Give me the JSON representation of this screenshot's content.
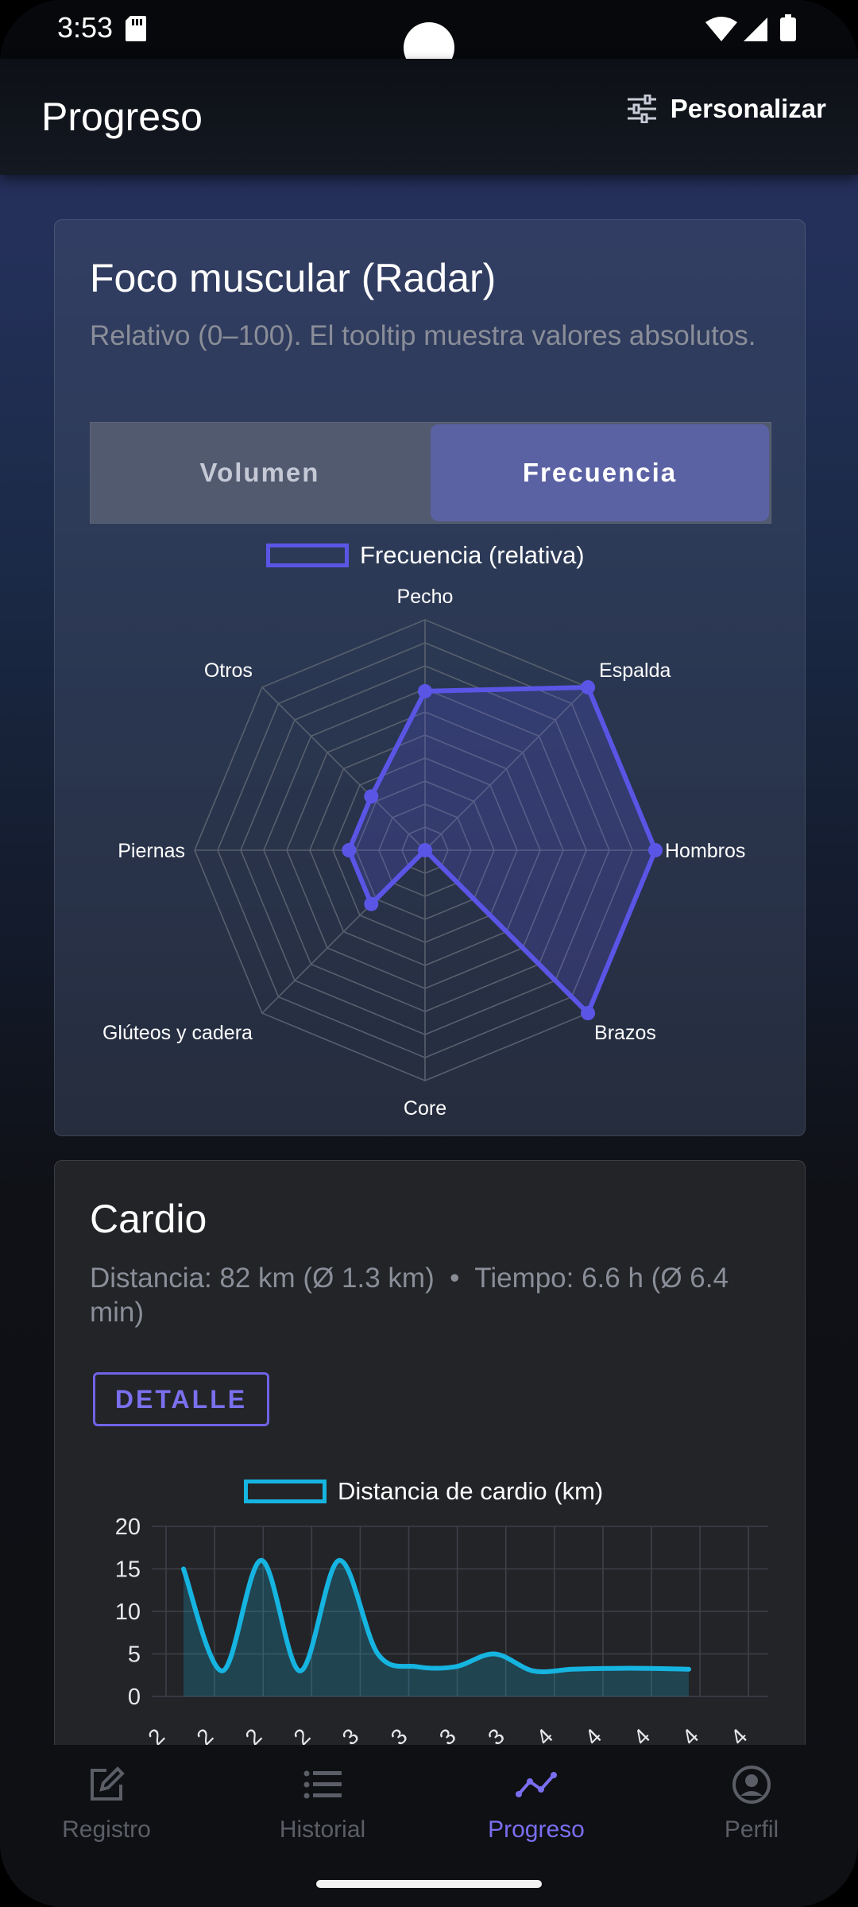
{
  "status_bar": {
    "time": "3:53"
  },
  "app_bar": {
    "title": "Progreso",
    "customize_label": "Personalizar"
  },
  "radar_card": {
    "title": "Foco muscular (Radar)",
    "subtitle": "Relativo (0–100). El tooltip muestra valores absolutos.",
    "tabs": [
      {
        "label": "Volumen",
        "selected": false
      },
      {
        "label": "Frecuencia",
        "selected": true
      }
    ]
  },
  "cardio_card": {
    "title": "Cardio",
    "summary": "Distancia: 82 km (Ø 1.3 km)  •  Tiempo: 6.6 h (Ø 6.4 min)",
    "detail_button": "DETALLE"
  },
  "bottom_nav": {
    "items": [
      {
        "label": "Registro",
        "icon": "edit-icon",
        "active": false
      },
      {
        "label": "Historial",
        "icon": "list-icon",
        "active": false
      },
      {
        "label": "Progreso",
        "icon": "trending-icon",
        "active": true
      },
      {
        "label": "Perfil",
        "icon": "account-icon",
        "active": false
      }
    ]
  },
  "colors": {
    "accent": "#5b55e6",
    "cardio_line": "#16b4e0",
    "nav_active": "#7a6ef0"
  },
  "chart_data": [
    {
      "type": "radar",
      "legend": [
        "Frecuencia (relativa)"
      ],
      "axes": [
        "Pecho",
        "Espalda",
        "Hombros",
        "Brazos",
        "Core",
        "Glúteos y cadera",
        "Piernas",
        "Otros"
      ],
      "series": [
        {
          "name": "Frecuencia (relativa)",
          "values": [
            69,
            100,
            100,
            100,
            0,
            33,
            33,
            33
          ]
        }
      ],
      "range": [
        0,
        100
      ]
    },
    {
      "type": "line",
      "legend": [
        "Distancia de cardio (km)"
      ],
      "series": [
        {
          "name": "Distancia de cardio (km)",
          "values": [
            15,
            3,
            16,
            3,
            16,
            5,
            3.5,
            3.5,
            5,
            3,
            3.2,
            3.3,
            3.3,
            3.2
          ]
        }
      ],
      "ylim": [
        0,
        20
      ],
      "yticks": [
        0,
        5,
        10,
        15,
        20
      ],
      "xtick_labels": [
        "…2",
        "…2",
        "…2",
        "…2",
        "…3",
        "…3",
        "…3",
        "…3",
        "…4",
        "…4",
        "…4",
        "…4",
        "…4"
      ]
    }
  ]
}
